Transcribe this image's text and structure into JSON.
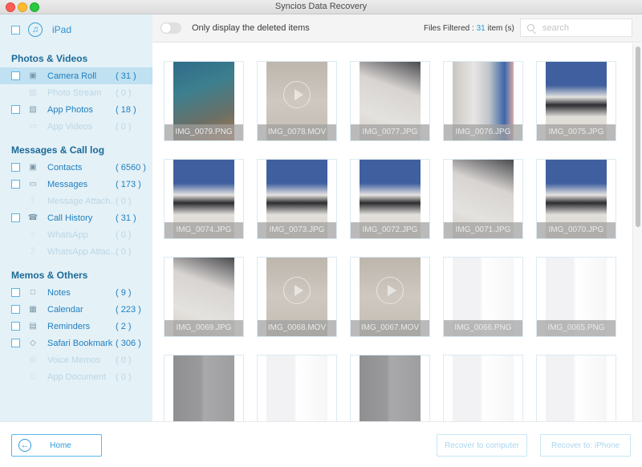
{
  "window": {
    "title": "Syncios Data Recovery"
  },
  "device": {
    "name": "iPad",
    "icon": "music-note-icon"
  },
  "sidebar": {
    "sections": [
      {
        "title": "Photos & Videos",
        "items": [
          {
            "label": "Camera Roll",
            "count": "( 31 )",
            "icon": "camera-icon",
            "enabled": true,
            "active": true
          },
          {
            "label": "Photo Stream",
            "count": "( 0 )",
            "icon": "photo-stream-icon",
            "enabled": false
          },
          {
            "label": "App Photos",
            "count": "( 18 )",
            "icon": "image-icon",
            "enabled": true
          },
          {
            "label": "App Videos",
            "count": "( 0 )",
            "icon": "video-icon",
            "enabled": false
          }
        ]
      },
      {
        "title": "Messages & Call log",
        "items": [
          {
            "label": "Contacts",
            "count": "( 6560 )",
            "icon": "contacts-icon",
            "enabled": true
          },
          {
            "label": "Messages",
            "count": "( 173 )",
            "icon": "message-icon",
            "enabled": true
          },
          {
            "label": "Message Attach...",
            "count": "( 0 )",
            "icon": "paperclip-icon",
            "enabled": false
          },
          {
            "label": "Call History",
            "count": "( 31 )",
            "icon": "phone-icon",
            "enabled": true
          },
          {
            "label": "WhatsApp",
            "count": "( 0 )",
            "icon": "whatsapp-icon",
            "enabled": false
          },
          {
            "label": "WhatsApp Attac...",
            "count": "( 0 )",
            "icon": "paperclip-icon",
            "enabled": false
          }
        ]
      },
      {
        "title": "Memos & Others",
        "items": [
          {
            "label": "Notes",
            "count": "( 9 )",
            "icon": "notes-icon",
            "enabled": true
          },
          {
            "label": "Calendar",
            "count": "( 223 )",
            "icon": "calendar-icon",
            "enabled": true
          },
          {
            "label": "Reminders",
            "count": "( 2 )",
            "icon": "reminders-icon",
            "enabled": true
          },
          {
            "label": "Safari Bookmark",
            "count": "( 306 )",
            "icon": "bookmark-tag-icon",
            "enabled": true
          },
          {
            "label": "Voice Memos",
            "count": "( 0 )",
            "icon": "microphone-icon",
            "enabled": false
          },
          {
            "label": "App Document",
            "count": "( 0 )",
            "icon": "document-icon",
            "enabled": false
          }
        ]
      }
    ]
  },
  "filter": {
    "toggle_label": "Only display the deleted items",
    "toggle_on": false,
    "files_filtered_prefix": "Files Filtered : ",
    "files_filtered_count": "31",
    "files_filtered_suffix": " item (s)",
    "search_placeholder": "search"
  },
  "files": [
    {
      "name": "IMG_0079.PNG",
      "type": "screenshot-home",
      "video": false
    },
    {
      "name": "IMG_0078.MOV",
      "type": "photo-floor",
      "video": true
    },
    {
      "name": "IMG_0077.JPG",
      "type": "photo-desk",
      "video": false
    },
    {
      "name": "IMG_0076.JPG",
      "type": "photo-office",
      "video": false
    },
    {
      "name": "IMG_0075.JPG",
      "type": "photo-desk-blue",
      "video": false
    },
    {
      "name": "IMG_0074.JPG",
      "type": "photo-desk-blue",
      "video": false
    },
    {
      "name": "IMG_0073.JPG",
      "type": "photo-desk-blue",
      "video": false
    },
    {
      "name": "IMG_0072.JPG",
      "type": "photo-desk-blue",
      "video": false
    },
    {
      "name": "IMG_0071.JPG",
      "type": "photo-desk",
      "video": false
    },
    {
      "name": "IMG_0070.JPG",
      "type": "photo-desk-blue",
      "video": false
    },
    {
      "name": "IMG_0069.JPG",
      "type": "photo-desk",
      "video": false
    },
    {
      "name": "IMG_0068.MOV",
      "type": "photo-floor",
      "video": true
    },
    {
      "name": "IMG_0067.MOV",
      "type": "photo-floor",
      "video": true
    },
    {
      "name": "IMG_0066.PNG",
      "type": "screenshot-settings",
      "video": false
    },
    {
      "name": "IMG_0065.PNG",
      "type": "screenshot-settings",
      "video": false
    },
    {
      "name": "",
      "type": "screenshot-settings-dark",
      "video": false
    },
    {
      "name": "",
      "type": "screenshot-settings",
      "video": false
    },
    {
      "name": "",
      "type": "screenshot-settings-dark",
      "video": false
    },
    {
      "name": "",
      "type": "screenshot-settings",
      "video": false
    },
    {
      "name": "",
      "type": "screenshot-settings",
      "video": false
    }
  ],
  "footer": {
    "home_label": "Home",
    "recover_computer_label": "Recover to computer",
    "recover_device_label": "Recover to: iPhone"
  }
}
